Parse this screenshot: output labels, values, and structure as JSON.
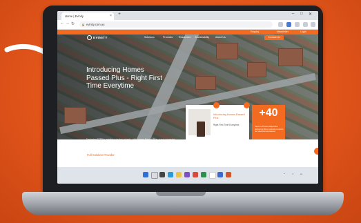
{
  "browser": {
    "tab_title": "Home | Evinity",
    "url": "evinity.com.au",
    "new_tab": "+",
    "win_controls": [
      "–",
      "□",
      "✕"
    ]
  },
  "site": {
    "topbar_links": [
      "Enquiry",
      "Newsletter",
      "Login"
    ],
    "logo": "EVINITY",
    "nav_links": [
      "Solutions",
      "Products",
      "Resources",
      "Sustainability",
      "About Us"
    ],
    "contact_label": "Contact Us",
    "headline": "Introducing Homes Passed Plus - Right First Time Everytime",
    "hero_description": "Deploying FTTP in existing suburban streets, with Homes Passed Plus, a pre-connected solution that delivers a quicker and easier rollout with fewer trips back to the home. Homes Passed Plus is installed before a customer orders a service.",
    "card_title": "Introducing Homes Passed Plus",
    "card_subtitle": "Right First Time Everytime",
    "plus_number": "+40",
    "plus_text": "Years of Proven Expertise delivering fibre network products for telecommunications.",
    "full_solution": "Full Solution Provider"
  },
  "colors": {
    "brand_orange": "#f26b21",
    "background": "#e0541a"
  },
  "icons": [
    "arrow-icon",
    "lock-icon",
    "back-icon",
    "forward-icon",
    "reload-icon",
    "start-icon",
    "search-icon",
    "edge-icon",
    "folder-icon",
    "chrome-icon"
  ]
}
